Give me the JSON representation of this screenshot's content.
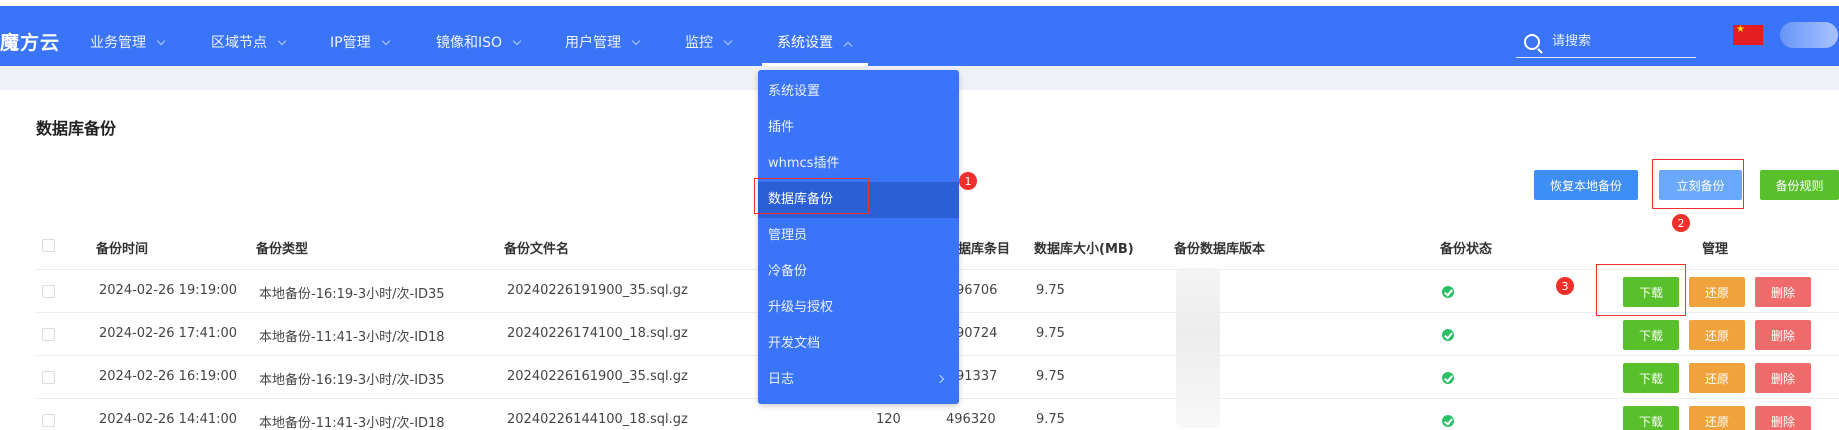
{
  "app": {
    "logo": "魔方云"
  },
  "nav": {
    "items": [
      {
        "label": "业务管理"
      },
      {
        "label": "区域节点"
      },
      {
        "label": "IP管理"
      },
      {
        "label": "镜像和ISO"
      },
      {
        "label": "用户管理"
      },
      {
        "label": "监控"
      },
      {
        "label": "系统设置"
      }
    ],
    "active": "系统设置",
    "search_placeholder": "请搜索"
  },
  "page": {
    "title": "数据库备份"
  },
  "toolbar": {
    "restore_local": "恢复本地备份",
    "backup_now": "立刻备份",
    "backup_rule": "备份规则"
  },
  "annotations": [
    "1",
    "2",
    "3"
  ],
  "dropdown": {
    "items": [
      {
        "label": "系统设置"
      },
      {
        "label": "插件"
      },
      {
        "label": "whmcs插件"
      },
      {
        "label": "数据库备份"
      },
      {
        "label": "管理员"
      },
      {
        "label": "冷备份"
      },
      {
        "label": "升级与授权"
      },
      {
        "label": "开发文档"
      },
      {
        "label": "日志"
      }
    ],
    "selected": "数据库备份"
  },
  "table": {
    "headers": {
      "time": "备份时间",
      "type": "备份类型",
      "file": "备份文件名",
      "entries": "据库条目",
      "size": "数据库大小(MB)",
      "version": "备份数据库版本",
      "status": "备份状态",
      "manage": "管理"
    },
    "rows": [
      {
        "time": "2024-02-26 19:19:00",
        "type": "本地备份-16:19-3小时/次-ID35",
        "file": "20240226191900_35.sql.gz",
        "tables": "",
        "entries": "96706",
        "size": "9.75"
      },
      {
        "time": "2024-02-26 17:41:00",
        "type": "本地备份-11:41-3小时/次-ID18",
        "file": "20240226174100_18.sql.gz",
        "tables": "",
        "entries": "90724",
        "size": "9.75"
      },
      {
        "time": "2024-02-26 16:19:00",
        "type": "本地备份-16:19-3小时/次-ID35",
        "file": "20240226161900_35.sql.gz",
        "tables": "",
        "entries": "91337",
        "size": "9.75"
      },
      {
        "time": "2024-02-26 14:41:00",
        "type": "本地备份-11:41-3小时/次-ID18",
        "file": "20240226144100_18.sql.gz",
        "tables": "120",
        "entries": "496320",
        "size": "9.75"
      }
    ],
    "actions": {
      "download": "下载",
      "restore": "还原",
      "delete": "删除"
    }
  },
  "colors": {
    "topbar": "#3a74f8",
    "dropdown_selected": "#2b5fd6",
    "download": "#58c02a",
    "restore": "#f0a33c",
    "delete": "#ef6b6b",
    "annotation": "#f0302a"
  }
}
